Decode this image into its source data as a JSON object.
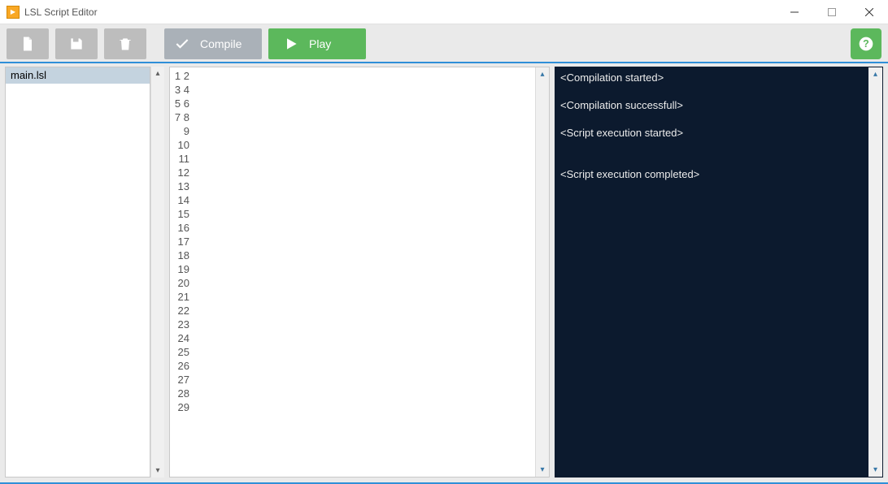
{
  "window": {
    "title": "LSL Script Editor"
  },
  "toolbar": {
    "new_label": "New",
    "save_label": "Save",
    "delete_label": "Delete",
    "compile_label": "Compile",
    "play_label": "Play",
    "help_label": "Help"
  },
  "sidebar": {
    "files": [
      {
        "name": "main.lsl",
        "selected": true
      }
    ]
  },
  "editor": {
    "line_count": 29
  },
  "console": {
    "lines": [
      "<Compilation started>",
      "",
      "<Compilation successfull>",
      "",
      "<Script execution started>",
      "",
      "",
      "<Script execution completed>"
    ]
  }
}
